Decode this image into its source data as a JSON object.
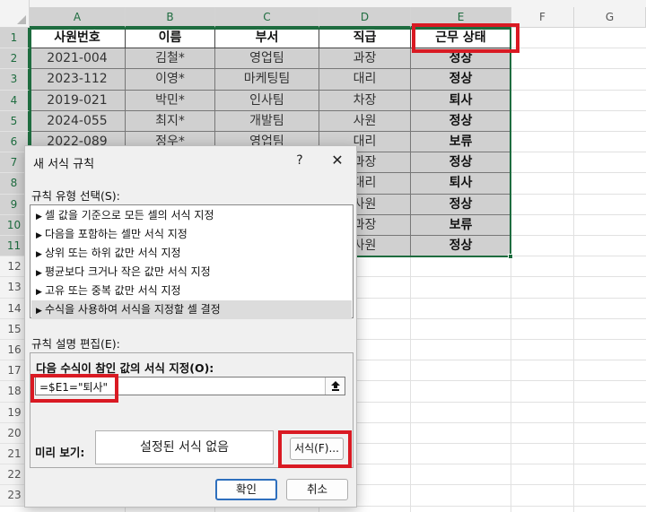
{
  "spreadsheet": {
    "columns": [
      "A",
      "B",
      "C",
      "D",
      "E",
      "F",
      "G"
    ],
    "rows": [
      "1",
      "2",
      "3",
      "4",
      "5",
      "6",
      "7",
      "8",
      "9",
      "10",
      "11",
      "12",
      "13",
      "14",
      "15",
      "16",
      "17",
      "18",
      "19",
      "20",
      "21",
      "22",
      "23"
    ],
    "headers": [
      "사원번호",
      "이름",
      "부서",
      "직급",
      "근무 상태"
    ],
    "data": [
      [
        "2021-004",
        "김철*",
        "영업팀",
        "과장",
        "정상"
      ],
      [
        "2023-112",
        "이영*",
        "마케팅팀",
        "대리",
        "정상"
      ],
      [
        "2019-021",
        "박민*",
        "인사팀",
        "차장",
        "퇴사"
      ],
      [
        "2024-055",
        "최지*",
        "개발팀",
        "사원",
        "정상"
      ],
      [
        "2022-089",
        "정우*",
        "영업팀",
        "대리",
        "보류"
      ],
      [
        "",
        "",
        "",
        "과장",
        "정상"
      ],
      [
        "",
        "",
        "",
        "대리",
        "퇴사"
      ],
      [
        "",
        "",
        "",
        "사원",
        "정상"
      ],
      [
        "",
        "",
        "",
        "과장",
        "보류"
      ],
      [
        "",
        "",
        "",
        "사원",
        "정상"
      ]
    ]
  },
  "dialog": {
    "title": "새 서식 규칙",
    "help": "?",
    "close": "✕",
    "rule_type_label": "규칙 유형 선택(S):",
    "rule_types": [
      "셀 값을 기준으로 모든 셀의 서식 지정",
      "다음을 포함하는 셀만 서식 지정",
      "상위 또는 하위 값만 서식 지정",
      "평균보다 크거나 작은 값만 서식 지정",
      "고유 또는 중복 값만 서식 지정",
      "수식을 사용하여 서식을 지정할 셀 결정"
    ],
    "selected_rule_index": 5,
    "edit_label": "규칙 설명 편집(E):",
    "formula_label": "다음 수식이 참인 값의 서식 지정(O):",
    "formula_value": "=$E1=\"퇴사\"",
    "preview_label": "미리 보기:",
    "preview_text": "설정된 서식 없음",
    "format_button": "서식(F)...",
    "ok_button": "확인",
    "cancel_button": "취소"
  },
  "colors": {
    "selection_green": "#1e6c3f",
    "highlight_red": "#d91a23",
    "data_fill": "#d0d0d0"
  }
}
